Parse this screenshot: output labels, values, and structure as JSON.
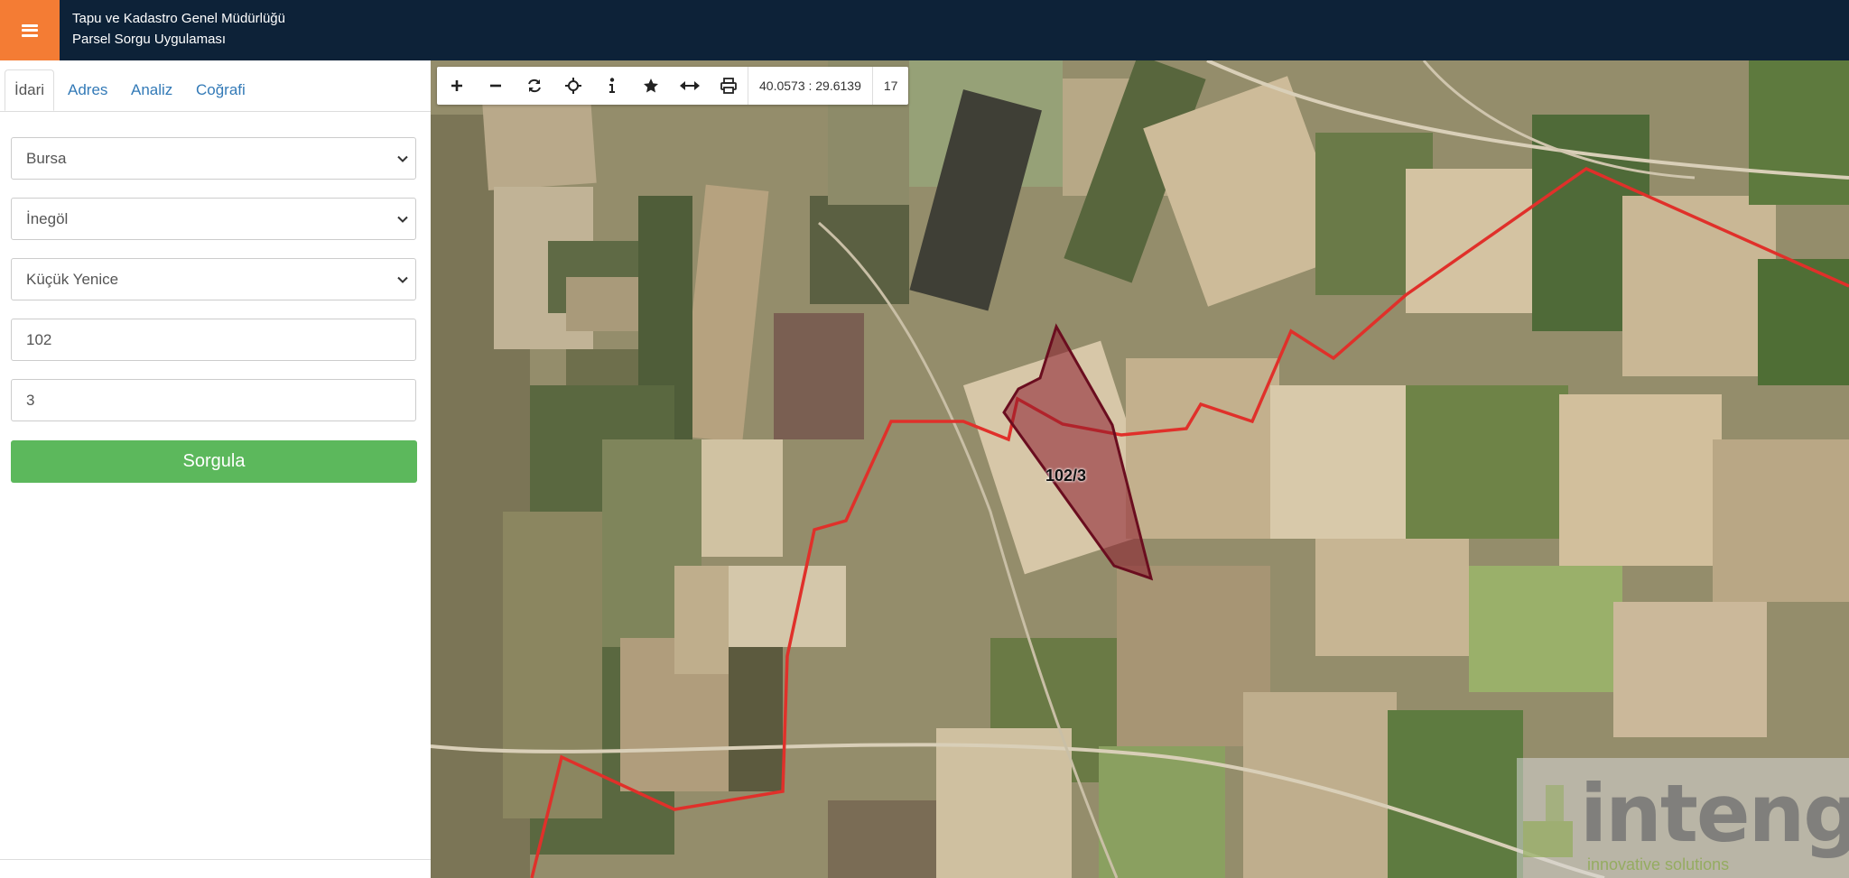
{
  "header": {
    "title_line1": "Tapu ve Kadastro Genel Müdürlüğü",
    "title_line2": "Parsel Sorgu Uygulaması",
    "menu_icon": "hamburger-icon"
  },
  "sidebar": {
    "tabs": [
      {
        "label": "İdari",
        "active": true
      },
      {
        "label": "Adres",
        "active": false
      },
      {
        "label": "Analiz",
        "active": false
      },
      {
        "label": "Coğrafi",
        "active": false
      }
    ],
    "province": "Bursa",
    "district": "İnegöl",
    "neighborhood": "Küçük Yenice",
    "block_no": "102",
    "parcel_no": "3",
    "query_label": "Sorgula"
  },
  "map": {
    "coordinates": "40.0573 : 29.6139",
    "zoom": "17",
    "parcel_label": "102/3",
    "logo_text": "intengo",
    "logo_subtext": "innovative solutions",
    "toolbar_icons": [
      "zoom-in-icon",
      "zoom-out-icon",
      "refresh-icon",
      "locate-icon",
      "info-icon",
      "star-icon",
      "measure-icon",
      "print-icon"
    ],
    "colors": {
      "boundary": "#e0302a",
      "parcel_fill": "#8b1a2b",
      "parcel_stroke": "#6a0d1f"
    }
  }
}
